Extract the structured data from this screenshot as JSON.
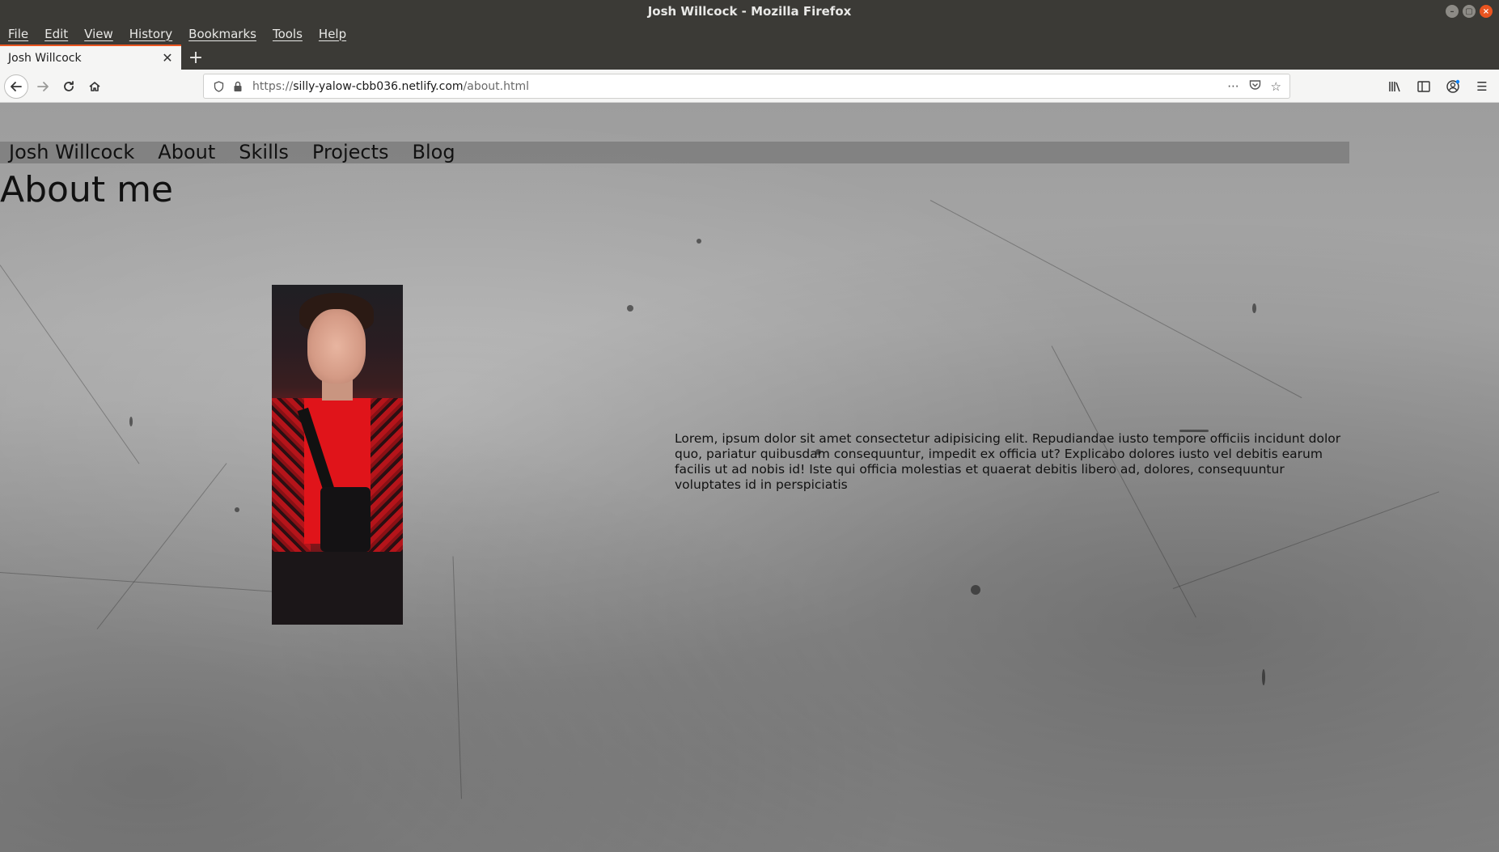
{
  "window": {
    "title": "Josh Willcock - Mozilla Firefox"
  },
  "menubar": {
    "items": [
      "File",
      "Edit",
      "View",
      "History",
      "Bookmarks",
      "Tools",
      "Help"
    ]
  },
  "tabs": [
    {
      "label": "Josh Willcock",
      "active": true
    }
  ],
  "navbar": {
    "url_prefix": "https://",
    "url_domain": "silly-yalow-cbb036.netlify.com",
    "url_path": "/about.html"
  },
  "site": {
    "nav": [
      "Josh Willcock",
      "About",
      "Skills",
      "Projects",
      "Blog"
    ],
    "heading": "About me",
    "paragraph": "Lorem, ipsum dolor sit amet consectetur adipisicing elit. Repudiandae iusto tempore officiis incidunt dolor quo, pariatur quibusdam consequuntur, impedit ex officia ut? Explicabo dolores iusto vel debitis earum facilis ut ad nobis id! Iste qui officia molestias et quaerat debitis libero ad, dolores, consequuntur voluptates id in perspiciatis"
  },
  "colors": {
    "accent": "#e95420",
    "chrome": "#3b3a36",
    "toolbar": "#f5f5f4"
  },
  "icons": {
    "back": "arrow-left",
    "forward": "arrow-right",
    "reload": "reload",
    "home": "home",
    "tracking_protection": "shield",
    "secure": "lock",
    "page_actions": "ellipsis",
    "pocket": "pocket",
    "bookmark": "star",
    "library": "library",
    "sidebar": "sidebar",
    "account": "account",
    "menu": "hamburger"
  }
}
